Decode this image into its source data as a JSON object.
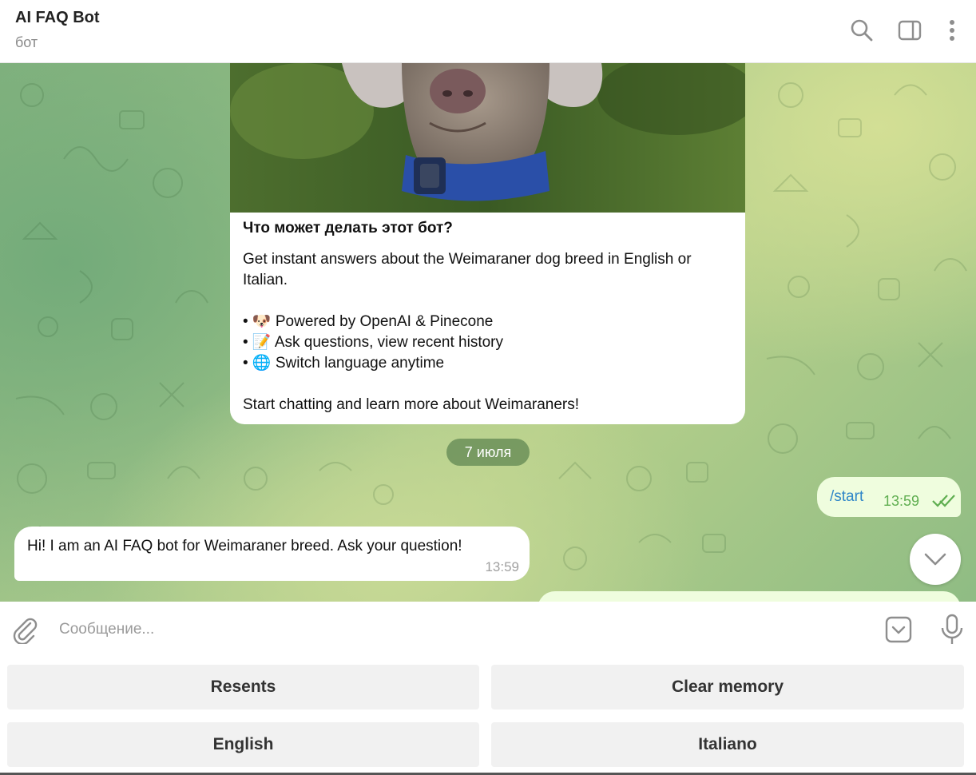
{
  "header": {
    "title": "AI FAQ Bot",
    "subtitle": "бот",
    "icons": [
      "search-icon",
      "sidebar-icon",
      "more-vertical-icon"
    ]
  },
  "intro_card": {
    "heading": "Что может делать этот бот?",
    "description_lines": [
      "Get instant answers about the Weimaraner dog breed in English or Italian."
    ],
    "features": [
      "• 🐶 Powered by OpenAI & Pinecone",
      "• 📝 Ask questions, view recent history",
      "• 🌐 Switch language anytime"
    ],
    "closing": "Start chatting and learn more about Weimaraners!"
  },
  "date_separator": "7 июля",
  "messages": [
    {
      "direction": "outgoing",
      "text": "/start",
      "time": "13:59",
      "status": "read"
    },
    {
      "direction": "incoming",
      "text": "Hi! I am an AI FAQ bot for Weimaraner breed. Ask your question!",
      "time": "13:59"
    }
  ],
  "composer": {
    "placeholder": "Сообщение..."
  },
  "keyboard": {
    "buttons": [
      "Resents",
      "Clear memory",
      "English",
      "Italiano"
    ]
  },
  "colors": {
    "outgoing_bubble": "#effdde",
    "link": "#2f86c8",
    "read_ticks": "#5fae50",
    "date_pill": "#4e7846"
  }
}
